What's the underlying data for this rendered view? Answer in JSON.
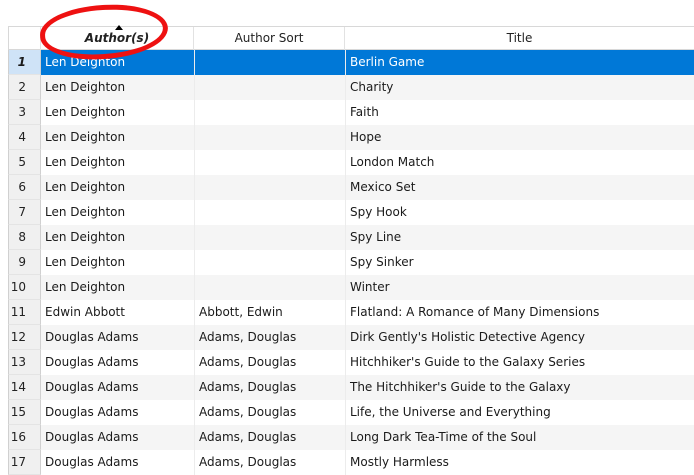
{
  "header": {
    "author_label": "Author(s)",
    "author_sort_label": "Author Sort",
    "title_label": "Title",
    "sort_direction": "ascending"
  },
  "colors": {
    "selection": "#0078d7",
    "annotation": "#ee1111"
  },
  "rows": [
    {
      "num": "1",
      "author": "Len Deighton",
      "author_sort": "",
      "title": "Berlin Game",
      "selected": true
    },
    {
      "num": "2",
      "author": "Len Deighton",
      "author_sort": "",
      "title": "Charity"
    },
    {
      "num": "3",
      "author": "Len Deighton",
      "author_sort": "",
      "title": "Faith"
    },
    {
      "num": "4",
      "author": "Len Deighton",
      "author_sort": "",
      "title": "Hope"
    },
    {
      "num": "5",
      "author": "Len Deighton",
      "author_sort": "",
      "title": "London Match"
    },
    {
      "num": "6",
      "author": "Len Deighton",
      "author_sort": "",
      "title": "Mexico Set"
    },
    {
      "num": "7",
      "author": "Len Deighton",
      "author_sort": "",
      "title": "Spy Hook"
    },
    {
      "num": "8",
      "author": "Len Deighton",
      "author_sort": "",
      "title": "Spy Line"
    },
    {
      "num": "9",
      "author": "Len Deighton",
      "author_sort": "",
      "title": "Spy Sinker"
    },
    {
      "num": "10",
      "author": "Len Deighton",
      "author_sort": "",
      "title": "Winter"
    },
    {
      "num": "11",
      "author": "Edwin Abbott",
      "author_sort": "Abbott, Edwin",
      "title": "Flatland: A Romance of Many Dimensions"
    },
    {
      "num": "12",
      "author": "Douglas Adams",
      "author_sort": "Adams, Douglas",
      "title": "Dirk Gently's Holistic Detective Agency"
    },
    {
      "num": "13",
      "author": "Douglas Adams",
      "author_sort": "Adams, Douglas",
      "title": "Hitchhiker's Guide to the Galaxy Series"
    },
    {
      "num": "14",
      "author": "Douglas Adams",
      "author_sort": "Adams, Douglas",
      "title": "The Hitchhiker's Guide to the Galaxy"
    },
    {
      "num": "15",
      "author": "Douglas Adams",
      "author_sort": "Adams, Douglas",
      "title": "Life, the Universe and Everything"
    },
    {
      "num": "16",
      "author": "Douglas Adams",
      "author_sort": "Adams, Douglas",
      "title": "Long Dark Tea-Time of the Soul"
    },
    {
      "num": "17",
      "author": "Douglas Adams",
      "author_sort": "Adams, Douglas",
      "title": "Mostly Harmless"
    }
  ]
}
